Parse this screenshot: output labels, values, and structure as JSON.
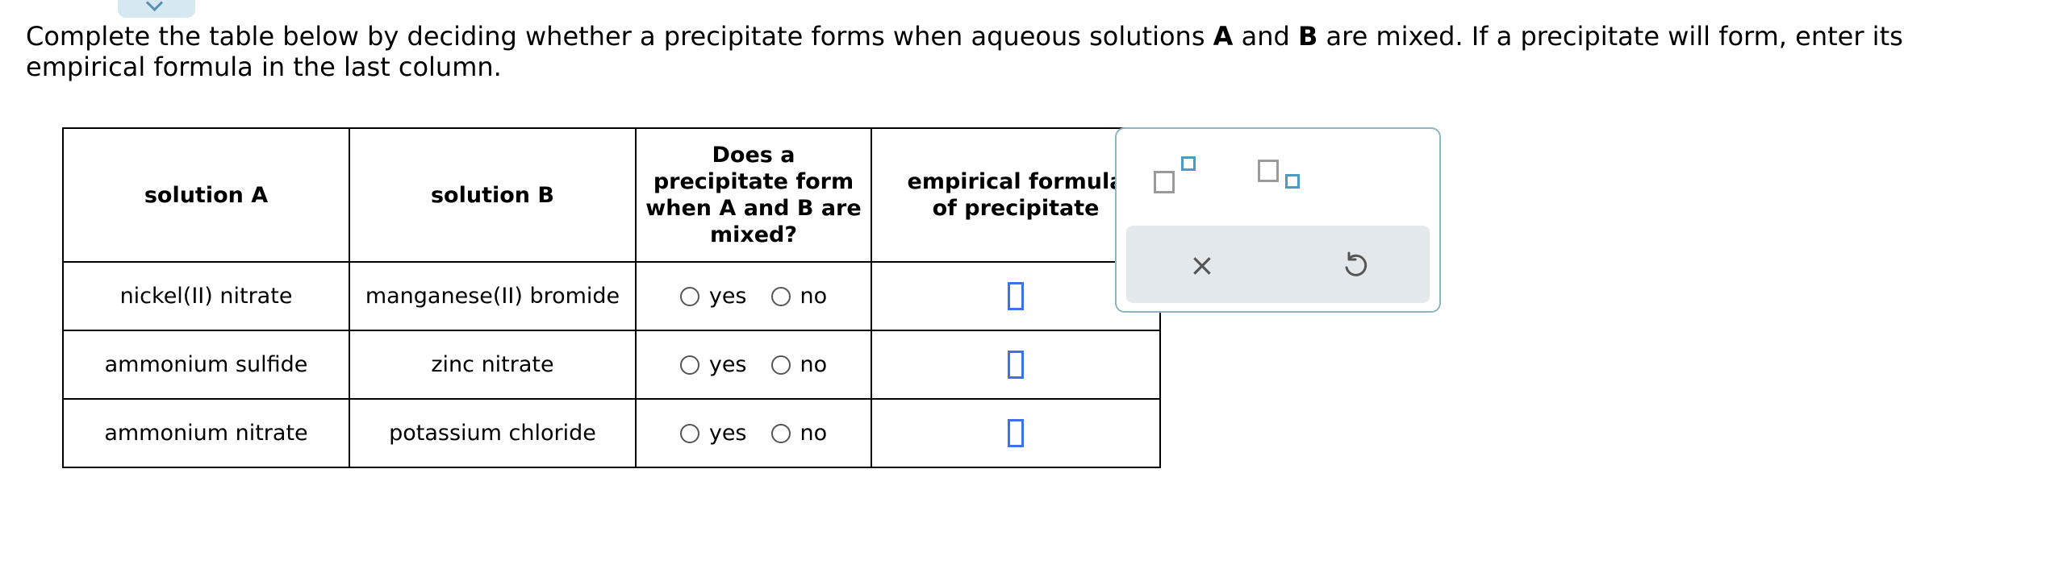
{
  "instructions": {
    "part1": "Complete the table below by deciding whether a precipitate forms when aqueous solutions ",
    "bold_a": "A",
    "part2": " and ",
    "bold_b": "B",
    "part3": " are mixed. If a precipitate will form, enter its empirical formula in the last column."
  },
  "table": {
    "headers": {
      "solution_a": "solution A",
      "solution_b": "solution B",
      "precipitate_q": "Does a precipitate form when A and B are mixed?",
      "formula": "empirical formula of precipitate"
    },
    "rows": [
      {
        "solution_a": "nickel(II) nitrate",
        "solution_b": "manganese(II) bromide",
        "yes": "yes",
        "no": "no"
      },
      {
        "solution_a": "ammonium sulfide",
        "solution_b": "zinc nitrate",
        "yes": "yes",
        "no": "no"
      },
      {
        "solution_a": "ammonium nitrate",
        "solution_b": "potassium chloride",
        "yes": "yes",
        "no": "no"
      }
    ]
  },
  "tools": {
    "superscript_icon": "superscript-icon",
    "subscript_icon": "subscript-icon",
    "clear_icon": "close-icon",
    "undo_icon": "undo-icon",
    "clear_glyph": "×"
  },
  "colors": {
    "accent_blue": "#3b73e0",
    "panel_border": "#8fb5c8",
    "toolbar_bg": "#e3e8ec"
  }
}
